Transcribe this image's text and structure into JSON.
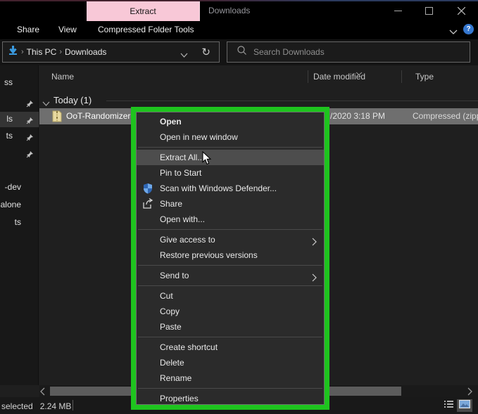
{
  "window": {
    "title": "Downloads",
    "contextual_tab_label": "Extract"
  },
  "ribbon": {
    "tabs": [
      {
        "label": "Share"
      },
      {
        "label": "View"
      },
      {
        "label": "Compressed Folder Tools"
      }
    ],
    "help_label": "?"
  },
  "address_bar": {
    "crumbs": [
      {
        "label": "This PC"
      },
      {
        "label": "Downloads"
      }
    ],
    "refresh_glyph": "↻"
  },
  "search": {
    "placeholder": "Search Downloads"
  },
  "columns": {
    "name": "Name",
    "date_modified": "Date modified",
    "type": "Type"
  },
  "sidebar": {
    "items": [
      {
        "label": "ss",
        "pinned": false,
        "selected": false
      },
      {
        "label": "",
        "pinned": true,
        "selected": false
      },
      {
        "label": "ls",
        "pinned": true,
        "selected": true
      },
      {
        "label": "ts",
        "pinned": true,
        "selected": false
      },
      {
        "label": "",
        "pinned": true,
        "selected": false
      },
      {
        "label": "-dev",
        "pinned": false,
        "selected": false
      },
      {
        "label": "ndalone",
        "pinned": false,
        "selected": false
      },
      {
        "label": "ts",
        "pinned": false,
        "selected": false
      }
    ]
  },
  "list": {
    "group_header": "Today (1)",
    "file": {
      "name": "OoT-Randomizer-",
      "date_modified_visible": "/2020 3:18 PM",
      "type_visible": "Compressed (zipp"
    }
  },
  "context_menu": {
    "items": [
      {
        "label": "Open"
      },
      {
        "label": "Open in new window"
      },
      {
        "label": "Extract All..."
      },
      {
        "label": "Pin to Start"
      },
      {
        "label": "Scan with Windows Defender..."
      },
      {
        "label": "Share"
      },
      {
        "label": "Open with..."
      },
      {
        "label": "Give access to"
      },
      {
        "label": "Restore previous versions"
      },
      {
        "label": "Send to"
      },
      {
        "label": "Cut"
      },
      {
        "label": "Copy"
      },
      {
        "label": "Paste"
      },
      {
        "label": "Create shortcut"
      },
      {
        "label": "Delete"
      },
      {
        "label": "Rename"
      },
      {
        "label": "Properties"
      }
    ]
  },
  "status_bar": {
    "selected_text": "selected",
    "size_text": "2.24 MB"
  },
  "colors": {
    "annotation_green": "#1ec41e",
    "contextual_tab_pink": "#f8c8d7",
    "selection_gray": "#6f6f6f",
    "menu_background": "#2b2b2b",
    "menu_highlight": "#4d4d4d",
    "defender_blue": "#3a7bd5",
    "help_blue": "#3577cf"
  }
}
